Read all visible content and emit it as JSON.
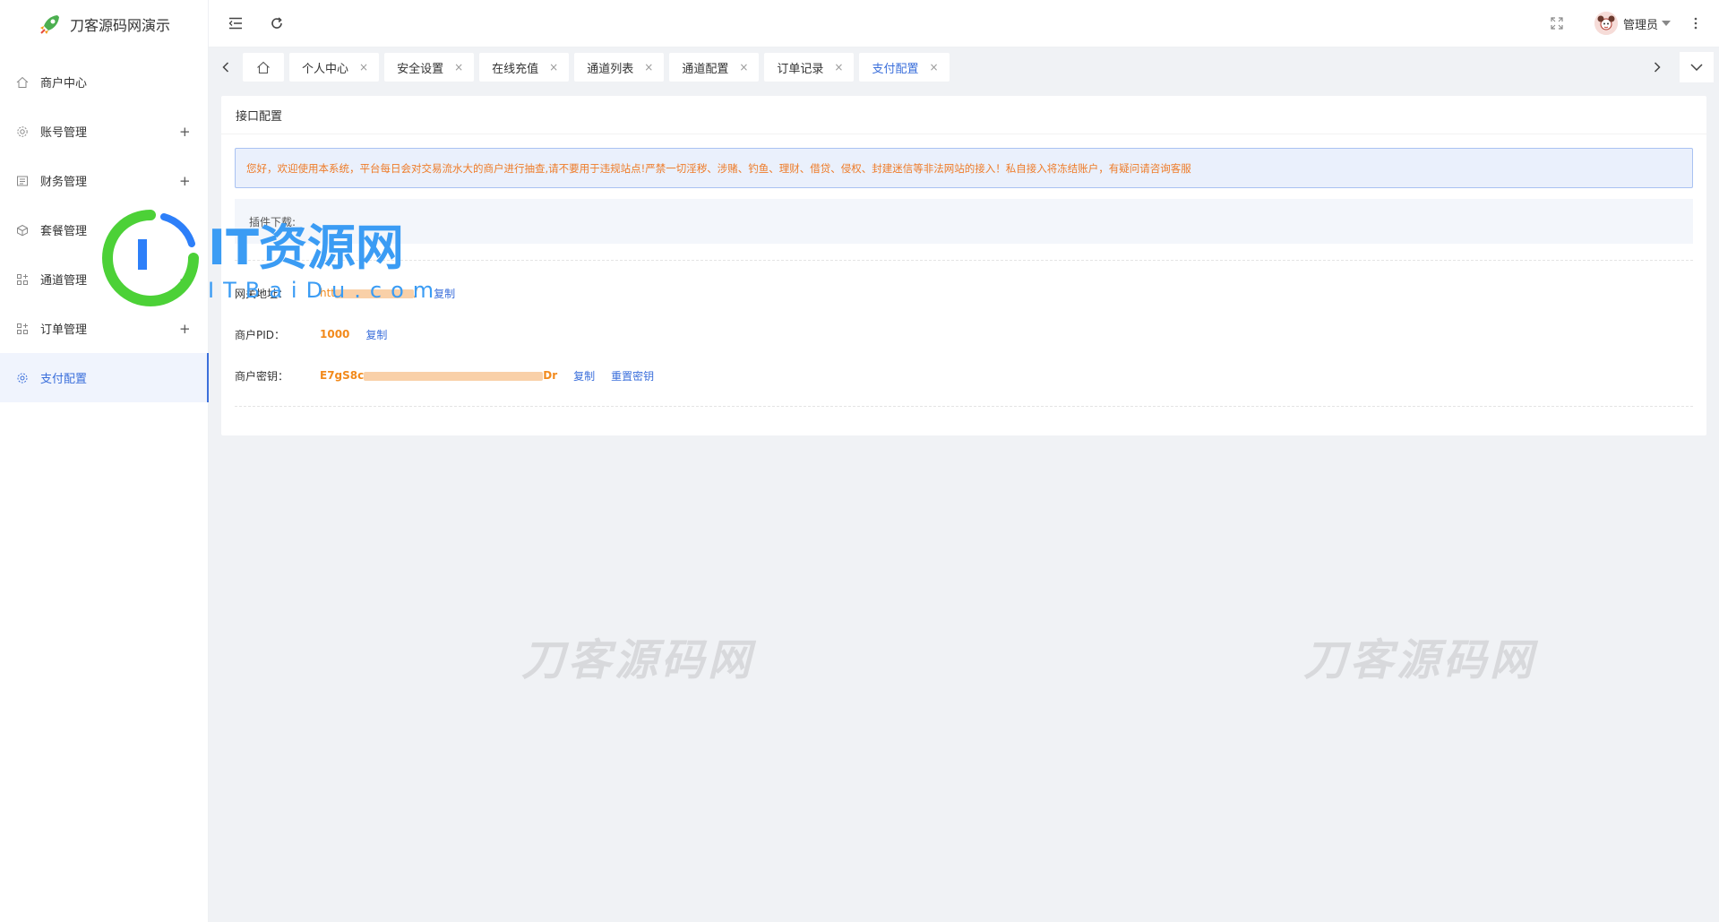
{
  "app": {
    "title": "刀客源码网演示"
  },
  "sidebar": {
    "items": [
      {
        "label": "商户中心",
        "icon": "home-icon",
        "expandable": false
      },
      {
        "label": "账号管理",
        "icon": "gear-icon",
        "expandable": true,
        "expand": "+"
      },
      {
        "label": "财务管理",
        "icon": "finance-icon",
        "expandable": true,
        "expand": "+"
      },
      {
        "label": "套餐管理",
        "icon": "package-icon",
        "expandable": true,
        "expand": "+"
      },
      {
        "label": "通道管理",
        "icon": "apps-icon",
        "expandable": true,
        "expand": "+"
      },
      {
        "label": "订单管理",
        "icon": "apps-icon",
        "expandable": true,
        "expand": "+"
      },
      {
        "label": "支付配置",
        "icon": "settings-icon",
        "expandable": false,
        "active": true
      }
    ]
  },
  "header": {
    "user_name": "管理员"
  },
  "tabs": {
    "items": [
      {
        "label": "个人中心",
        "close": "×"
      },
      {
        "label": "安全设置",
        "close": "×"
      },
      {
        "label": "在线充值",
        "close": "×"
      },
      {
        "label": "通道列表",
        "close": "×"
      },
      {
        "label": "通道配置",
        "close": "×"
      },
      {
        "label": "订单记录",
        "close": "×"
      },
      {
        "label": "支付配置",
        "close": "×",
        "active": true
      }
    ]
  },
  "card": {
    "title": "接口配置",
    "notice": "您好，欢迎使用本系统，平台每日会对交易流水大的商户进行抽查,请不要用于违规站点!严禁一切淫秽、涉赌、钓鱼、理财、借贷、侵权、封建迷信等非法网站的接入！私自接入将冻结账户，有疑问请咨询客服",
    "plugin_label": "插件下载:",
    "gateway": {
      "label": "网关地址：",
      "value_prefix": "htt",
      "value_suffix": "/",
      "copy": "复制"
    },
    "pid": {
      "label": "商户PID：",
      "value": "1000",
      "copy": "复制"
    },
    "key": {
      "label": "商户密钥：",
      "value_prefix": "E7gS8c",
      "value_suffix": "Dr",
      "copy": "复制",
      "reset": "重置密钥"
    }
  },
  "watermarks": {
    "text_left": "刀客源码网",
    "text_right": "刀客源码网",
    "it_logo": "IT资源网",
    "it_sub": "ITBaiDu.com"
  },
  "colors": {
    "accent": "#3b6fdb",
    "notice_text": "#ee7b28",
    "value_orange": "#f28a1c",
    "logo_green": "#4cd137"
  }
}
